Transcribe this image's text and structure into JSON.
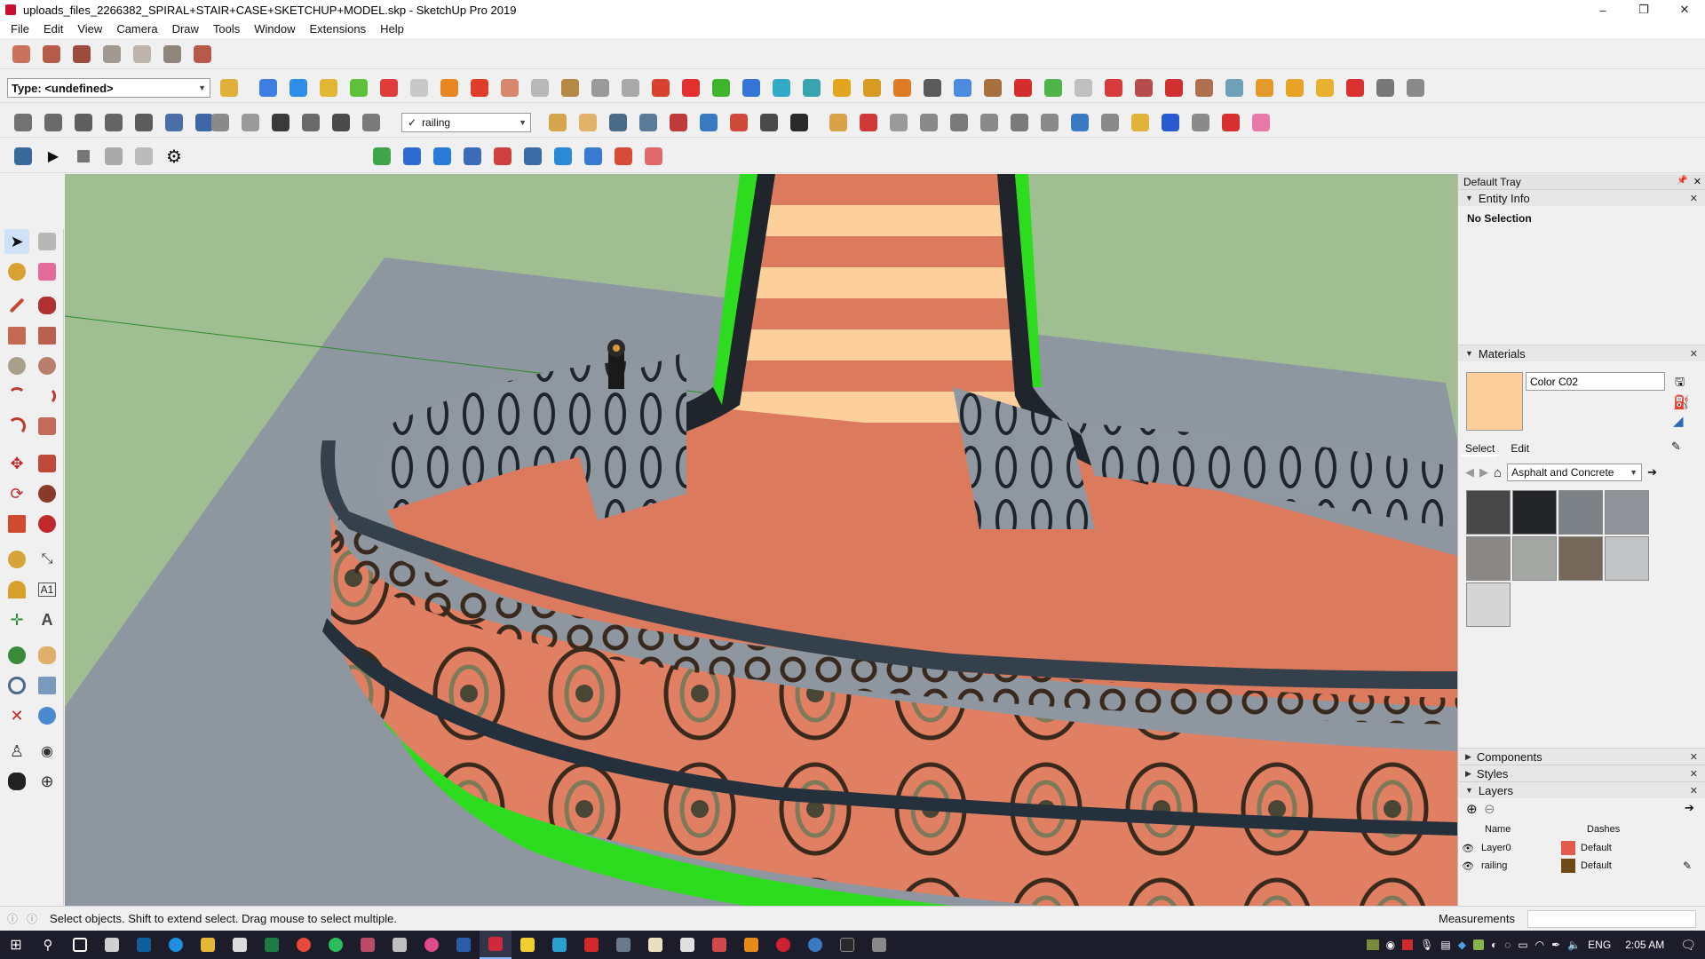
{
  "window": {
    "title": "uploads_files_2266382_SPIRAL+STAIR+CASE+SKETCHUP+MODEL.skp - SketchUp Pro 2019",
    "controls": [
      "–",
      "❐",
      "✕"
    ]
  },
  "menu": [
    "File",
    "Edit",
    "View",
    "Camera",
    "Draw",
    "Tools",
    "Window",
    "Extensions",
    "Help"
  ],
  "toolbar": {
    "type_combo": "Type: <undefined>",
    "layer_combo": "railing",
    "layer_check": "✓"
  },
  "colors": {
    "accent": "#1a5fb4",
    "stair_tread_light": "#fdcf9a",
    "stair_tread_dark": "#dc7a5e",
    "ground": "#8e97a0",
    "sky": "#9fbf92",
    "green": "#2edc1f",
    "rail": "#34404c",
    "selected_material": "#fdcf9a"
  },
  "tray": {
    "title": "Default Tray",
    "entity_info": {
      "title": "Entity Info",
      "selection": "No Selection"
    },
    "materials": {
      "title": "Materials",
      "name": "Color C02",
      "tabs": [
        "Select",
        "Edit"
      ],
      "collection": "Asphalt and Concrete",
      "swatches": [
        "#484848",
        "#232528",
        "#7c8186",
        "#8f9296",
        "#8a8785",
        "#a4a6a4",
        "#76695b",
        "#c1c3c5",
        "#d5d5d5"
      ]
    },
    "collapsed": [
      "Components",
      "Styles"
    ],
    "layers": {
      "title": "Layers",
      "col_name": "Name",
      "col_dashes": "Dashes",
      "rows": [
        {
          "name": "Layer0",
          "color": "#e25a4b",
          "dashes": "Default"
        },
        {
          "name": "railing",
          "color": "#6d4a16",
          "dashes": "Default"
        }
      ]
    }
  },
  "status": {
    "message": "Select objects. Shift to extend select. Drag mouse to select multiple.",
    "measurements_label": "Measurements"
  },
  "taskbar": {
    "lang": "ENG",
    "time": "2:05 AM"
  }
}
